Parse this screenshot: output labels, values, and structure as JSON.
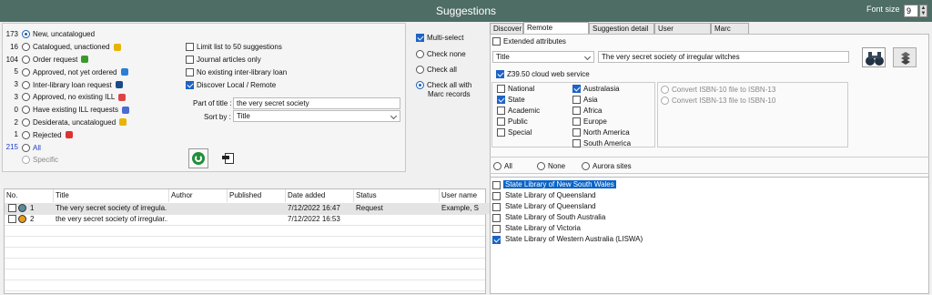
{
  "window": {
    "title": "Suggestions",
    "font_size_label": "Font size",
    "font_size_value": "9"
  },
  "status_filters": [
    {
      "count": "173",
      "label": "New, uncatalogued",
      "selected": true
    },
    {
      "count": "16",
      "label": "Catalogued, unactioned",
      "selected": false
    },
    {
      "count": "104",
      "label": "Order request",
      "selected": false
    },
    {
      "count": "5",
      "label": "Approved, not yet ordered",
      "selected": false
    },
    {
      "count": "3",
      "label": "Inter-library loan request",
      "selected": false
    },
    {
      "count": "3",
      "label": "Approved, no existing ILL",
      "selected": false
    },
    {
      "count": "0",
      "label": "Have existing ILL requests",
      "selected": false
    },
    {
      "count": "2",
      "label": "Desiderata, uncatalogued",
      "selected": false
    },
    {
      "count": "1",
      "label": "Rejected",
      "selected": false
    },
    {
      "count": "215",
      "label": "All",
      "selected": false
    },
    {
      "count": "",
      "label": "Specific",
      "selected": false
    }
  ],
  "options": {
    "limit": {
      "label": "Limit list to 50 suggestions",
      "checked": false
    },
    "journal": {
      "label": "Journal articles only",
      "checked": false
    },
    "no_ill": {
      "label": "No existing inter-library loan",
      "checked": false
    },
    "discover": {
      "label": "Discover Local / Remote",
      "checked": true
    }
  },
  "search": {
    "part_of_title_label": "Part of title :",
    "part_of_title_value": "the very secret society",
    "sort_by_label": "Sort by :",
    "sort_by_value": "Title"
  },
  "select_panel": {
    "multi_select": "Multi-select",
    "check_none": "Check none",
    "check_all": "Check all",
    "check_all_marc_1": "Check all with",
    "check_all_marc_2": "Marc records"
  },
  "table": {
    "columns": [
      "No.",
      "Title",
      "Author",
      "Published",
      "Date added",
      "Status",
      "User name"
    ],
    "rows": [
      {
        "no": "1",
        "title": "The very secret society of irregula...",
        "author": "",
        "published": "",
        "date_added": "7/12/2022 16:47",
        "status": "Request",
        "user": "Example, S"
      },
      {
        "no": "2",
        "title": "the very secret society of irregular...",
        "author": "",
        "published": "",
        "date_added": "7/12/2022 16:53",
        "status": "",
        "user": ""
      }
    ]
  },
  "tabs": [
    "Discover",
    "Remote catalogues",
    "Suggestion detail",
    "User notification",
    "Marc view"
  ],
  "remote": {
    "extended_attributes": "Extended attributes",
    "field_select": "Title",
    "query_value": "The very secret society of irregular witches",
    "z3950_label": "Z39.50 cloud web service",
    "col1": [
      {
        "label": "National",
        "checked": false
      },
      {
        "label": "State",
        "checked": true
      },
      {
        "label": "Academic",
        "checked": false
      },
      {
        "label": "Public",
        "checked": false
      },
      {
        "label": "Special",
        "checked": false
      }
    ],
    "col2": [
      {
        "label": "Australasia",
        "checked": true
      },
      {
        "label": "Asia",
        "checked": false
      },
      {
        "label": "Africa",
        "checked": false
      },
      {
        "label": "Europe",
        "checked": false
      },
      {
        "label": "North America",
        "checked": false
      },
      {
        "label": "South America",
        "checked": false
      }
    ],
    "convert_10_13": "Convert ISBN-10 file to ISBN-13",
    "convert_13_10": "Convert ISBN-13 file to ISBN-10",
    "scope_all": "All",
    "scope_none": "None",
    "scope_aurora": "Aurora sites",
    "sites": [
      {
        "label": "State Library of New South Wales",
        "checked": false,
        "selected": true
      },
      {
        "label": "State Library of Queensland",
        "checked": false,
        "selected": false
      },
      {
        "label": "State Library of Queensland",
        "checked": false,
        "selected": false
      },
      {
        "label": "State Library of South Australia",
        "checked": false,
        "selected": false
      },
      {
        "label": "State Library of Victoria",
        "checked": false,
        "selected": false
      },
      {
        "label": "State Library of Western Australia (LISWA)",
        "checked": true,
        "selected": false
      }
    ]
  },
  "colors": {
    "titlebar": "#4e6d64",
    "selection": "#0a64c8",
    "accent": "#1e63c6"
  }
}
